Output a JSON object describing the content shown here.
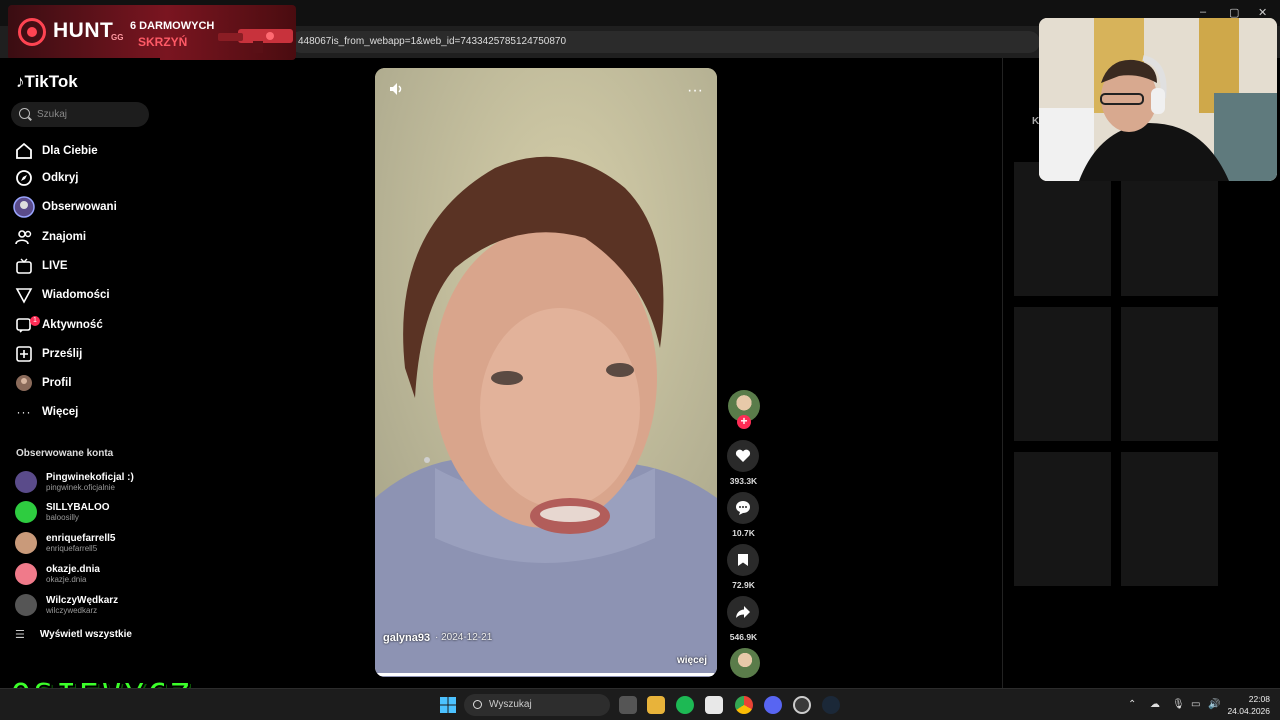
{
  "browser": {
    "url": "448067is_from_webapp=1&web_id=7433425785124750870",
    "window_buttons": [
      "–",
      "▢",
      "✕"
    ]
  },
  "hunt_banner": {
    "brand": "HUNT",
    "gg": "GG",
    "line1": "6 DARMOWYCH",
    "line2": "SKRZYŃ",
    "accent": "#ff4452"
  },
  "sidebar": {
    "logo": "TikTok",
    "search_placeholder": "Szukaj",
    "nav": [
      {
        "label": "Dla Ciebie",
        "icon": "home-icon"
      },
      {
        "label": "Odkryj",
        "icon": "compass-icon"
      },
      {
        "label": "Obserwowani",
        "icon": "following-avatar-icon"
      },
      {
        "label": "Znajomi",
        "icon": "friends-icon"
      },
      {
        "label": "LIVE",
        "icon": "live-tv-icon"
      },
      {
        "label": "Wiadomości",
        "icon": "send-icon"
      },
      {
        "label": "Aktywność",
        "icon": "activity-icon",
        "badge": "1"
      },
      {
        "label": "Prześlij",
        "icon": "upload-plus-icon"
      },
      {
        "label": "Profil",
        "icon": "profile-avatar-icon"
      },
      {
        "label": "Więcej",
        "icon": "more-dots-icon"
      }
    ],
    "followed_title": "Obserwowane konta",
    "accounts": [
      {
        "name": "Pingwinekoficjal :)",
        "handle": "pingwinek.oficjalnie",
        "color": "#5a4b8a"
      },
      {
        "name": "SILLYBALOO",
        "handle": "baloosilly",
        "color": "#2ecc40"
      },
      {
        "name": "enriquefarrell5",
        "handle": "enriquefarrell5",
        "color": "#c99a7a"
      },
      {
        "name": "okazje.dnia",
        "handle": "okazje.dnia",
        "color": "#f07a8a"
      },
      {
        "name": "WilczyWędkarz",
        "handle": "wilczywedkarz",
        "color": "#555555"
      }
    ],
    "see_all": "Wyświetl wszystkie"
  },
  "video": {
    "author": "galyna93",
    "date": "· 2024-12-21",
    "more": "więcej",
    "progress": 0.99
  },
  "actions": {
    "likes": "393.3K",
    "comments": "10.7K",
    "saves": "72.9K",
    "shares": "546.9K",
    "accent": "#fe2c55"
  },
  "right_panel": {
    "label": "K"
  },
  "overlay": {
    "channel_logo": "OSIEVYCZ",
    "logo_color": "#3cff2a"
  },
  "taskbar": {
    "search_label": "Wyszukaj",
    "time": "22:08",
    "date": "24.04.2026"
  }
}
